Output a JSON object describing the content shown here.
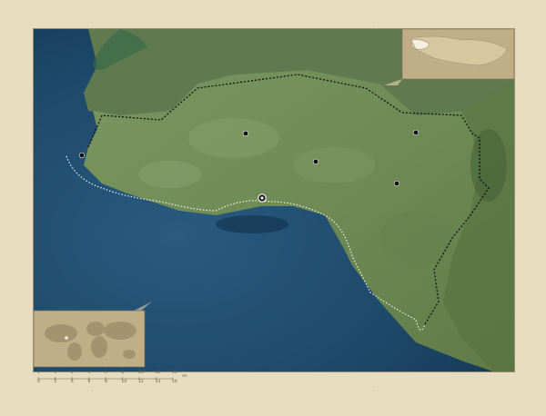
{
  "map": {
    "type": "satellite",
    "colors": {
      "frame_bg": "#e7dcc0",
      "sea": "#1e4a6b",
      "land": "#6e8a55",
      "boundary": "#111111",
      "inset_bg": "#bfae86",
      "inset_highlight": "#f5efe1"
    },
    "markers": [
      {
        "kind": "town"
      },
      {
        "kind": "town"
      },
      {
        "kind": "town"
      },
      {
        "kind": "town"
      },
      {
        "kind": "town"
      },
      {
        "kind": "capital"
      }
    ]
  },
  "insets": {
    "locator": {
      "label": "Jamaica locator inset"
    },
    "world": {
      "label": "World overview inset"
    }
  },
  "scale_bar": {
    "top_ticks": [
      "0",
      "1",
      "2",
      "4",
      "6",
      "8",
      "10",
      "12",
      "14"
    ],
    "bottom_ticks": [
      "0",
      "2",
      "4",
      "6",
      "8",
      "10",
      "12",
      "14",
      "16"
    ],
    "unit": "mi"
  }
}
